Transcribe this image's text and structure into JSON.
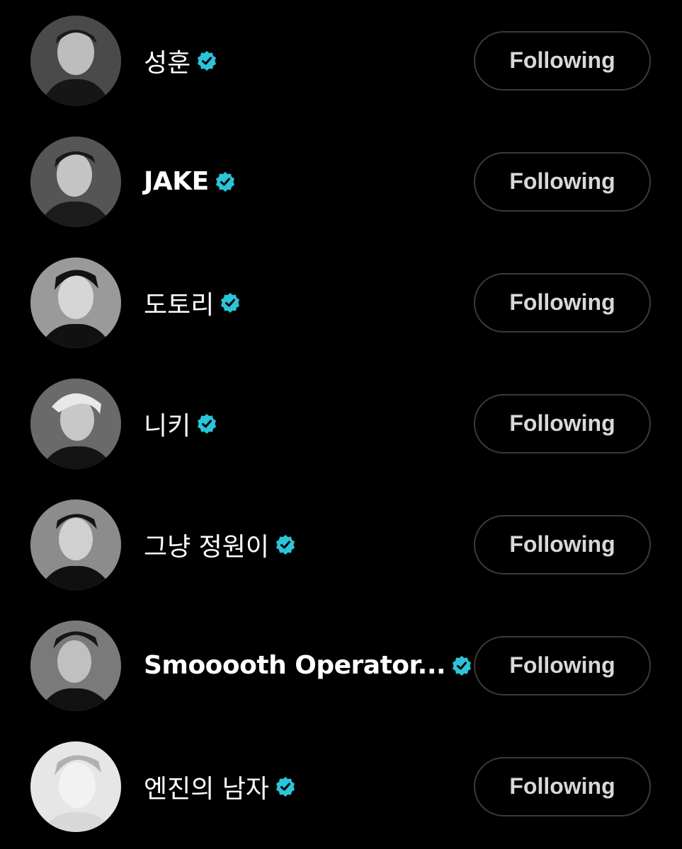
{
  "accent_color": "#2bc4d8",
  "follow_button_label": "Following",
  "users": [
    {
      "name": "성훈",
      "verified": true,
      "avatar": "avatar-photo-grayscale"
    },
    {
      "name": "JAKE",
      "verified": true,
      "avatar": "avatar-photo-grayscale"
    },
    {
      "name": "도토리",
      "verified": true,
      "avatar": "avatar-photo-grayscale"
    },
    {
      "name": "니키",
      "verified": true,
      "avatar": "avatar-photo-grayscale"
    },
    {
      "name": "그냥 정원이",
      "verified": true,
      "avatar": "avatar-photo-grayscale"
    },
    {
      "name": "Smooooth Operator...",
      "verified": true,
      "avatar": "avatar-photo-grayscale"
    },
    {
      "name": "엔진의 남자",
      "verified": true,
      "avatar": "avatar-photo-light"
    }
  ],
  "button_labels": [
    "Following",
    "Following",
    "Following",
    "Following",
    "Following",
    "Following",
    "Following"
  ]
}
